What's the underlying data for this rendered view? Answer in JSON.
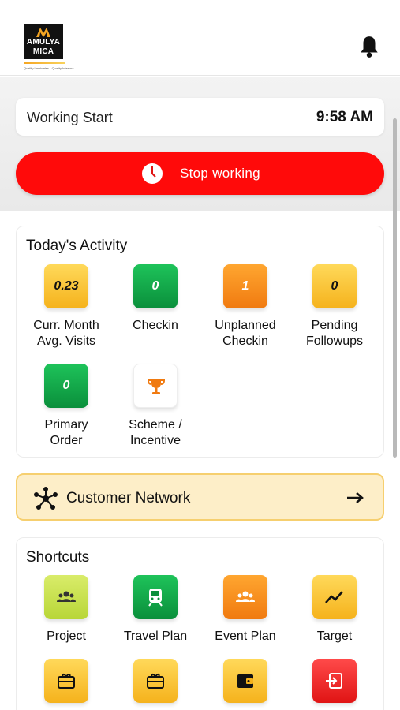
{
  "header": {
    "logo_line1": "AMULYA",
    "logo_line2": "MICA",
    "logo_tagline": "Quality Laminates · Quality Interiors",
    "notification_icon": "bell-icon"
  },
  "working": {
    "label": "Working Start",
    "time": "9:58 AM",
    "stop_button_label": "Stop working",
    "stop_icon": "clock-icon"
  },
  "activity": {
    "title": "Today's Activity",
    "tiles": [
      {
        "value": "0.23",
        "label": "Curr. Month Avg. Visits",
        "color": "#f5b21c"
      },
      {
        "value": "0",
        "label": "Checkin",
        "color": "#0a8f3b"
      },
      {
        "value": "1",
        "label": "Unplanned Checkin",
        "color": "#f07a10"
      },
      {
        "value": "0",
        "label": "Pending Followups",
        "color": "#f5b21c"
      },
      {
        "value": "0",
        "label": "Primary Order",
        "color": "#0a8f3b"
      },
      {
        "value": "",
        "label": "Scheme / Incentive",
        "icon": "trophy-icon",
        "color": "#f07a10"
      }
    ]
  },
  "network": {
    "label": "Customer Network",
    "icon": "network-icon",
    "arrow_icon": "arrow-right-icon"
  },
  "shortcuts": {
    "title": "Shortcuts",
    "items": [
      {
        "label": "Project",
        "icon": "group-icon",
        "color": "#b8d637"
      },
      {
        "label": "Travel Plan",
        "icon": "train-icon",
        "color": "#0a8f3b"
      },
      {
        "label": "Event Plan",
        "icon": "group-icon",
        "color": "#f07a10"
      },
      {
        "label": "Target",
        "icon": "trend-icon",
        "color": "#f5b21c"
      },
      {
        "label": "",
        "icon": "gift-card-icon",
        "color": "#f5b21c"
      },
      {
        "label": "",
        "icon": "gift-card-icon",
        "color": "#f5b21c"
      },
      {
        "label": "",
        "icon": "wallet-icon",
        "color": "#f5b21c"
      },
      {
        "label": "",
        "icon": "login-icon",
        "color": "#e01414"
      }
    ]
  }
}
